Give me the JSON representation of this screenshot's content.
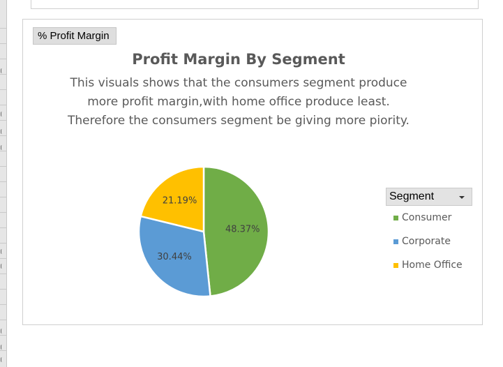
{
  "filter_button": {
    "label": "% Profit Margin"
  },
  "chart_data": {
    "type": "pie",
    "title": "Profit Margin By Segment",
    "subtitle_lines": [
      "This visuals shows that the consumers segment produce",
      "more profit margin,with home office produce least.",
      "Therefore the consumers segment be giving more piority."
    ],
    "categories": [
      "Consumer",
      "Corporate",
      "Home Office"
    ],
    "values": [
      48.37,
      30.44,
      21.19
    ],
    "value_labels": [
      "48.37%",
      "30.44%",
      "21.19%"
    ],
    "colors": [
      "#70ad47",
      "#5b9bd5",
      "#ffc000"
    ],
    "legend": {
      "title": "Segment",
      "position": "right",
      "items": [
        "Consumer",
        "Corporate",
        "Home Office"
      ]
    }
  }
}
